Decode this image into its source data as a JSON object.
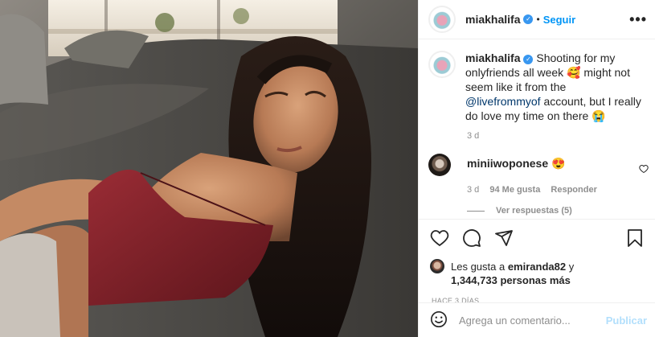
{
  "post": {
    "username": "miakhalifa",
    "follow_label": "Seguir",
    "dot": "•",
    "more_label": "•••"
  },
  "caption": {
    "username": "miakhalifa",
    "text_before_link": "Shooting for my onlyfriends all week 🥰 might not seem like it from the ",
    "link": "@livefrommyof",
    "text_after_link": " account, but I really do love my time on there 😭",
    "time": "3 d"
  },
  "comment": {
    "username": "miniiwoponese",
    "text": "😍",
    "time": "3 d",
    "likes": "94 Me gusta",
    "reply_label": "Responder",
    "view_replies": "Ver respuestas (5)"
  },
  "likes": {
    "prefix": "Les gusta a ",
    "user": "emiranda82",
    "connector": " y",
    "count": "1,344,733 personas más"
  },
  "posted_ago": "HACE 3 DÍAS",
  "comment_box": {
    "placeholder": "Agrega un comentario...",
    "publish_label": "Publicar"
  },
  "icons": {
    "like": "heart-icon",
    "comment": "comment-icon",
    "share": "share-icon",
    "save": "bookmark-icon",
    "emoji": "emoji-icon"
  },
  "colors": {
    "accent": "#0095f6",
    "verified": "#3897f0",
    "muted": "#8e8e8e",
    "publish_disabled": "#b2dffc"
  }
}
